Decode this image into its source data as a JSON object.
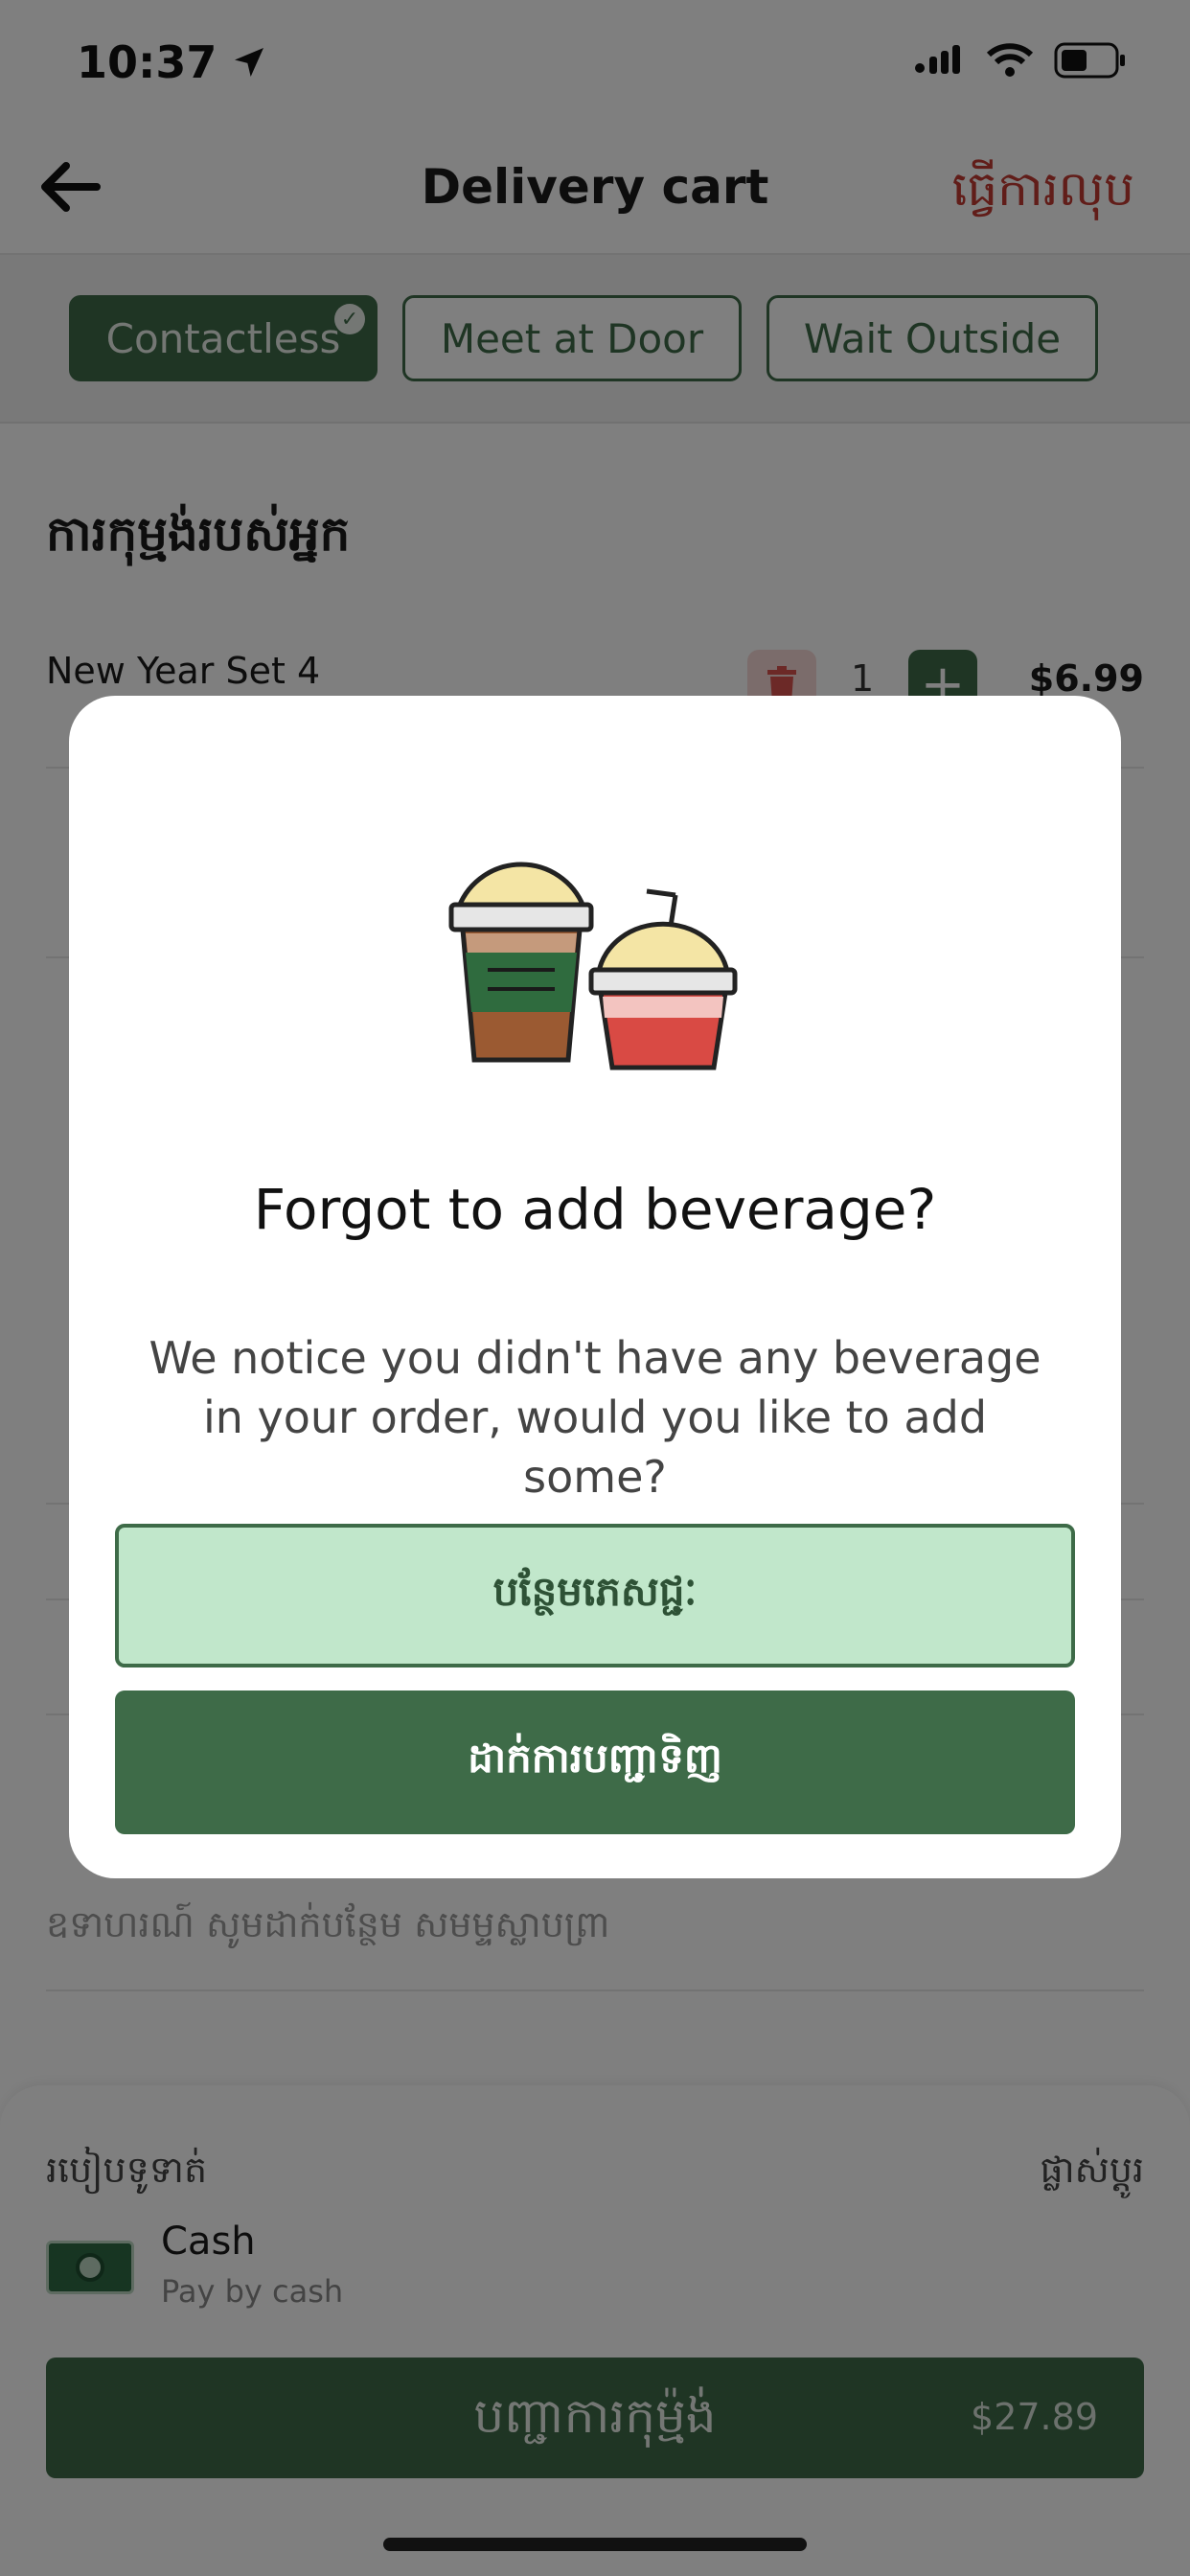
{
  "status_bar": {
    "time": "10:37"
  },
  "header": {
    "title": "Delivery cart",
    "clear_label": "ធ្វើការលុប"
  },
  "delivery_options": [
    {
      "label": "Contactless",
      "selected": true
    },
    {
      "label": "Meet at Door",
      "selected": false
    },
    {
      "label": "Wait Outside",
      "selected": false
    }
  ],
  "order": {
    "section_title": "ការកុម្មង់របស់អ្នក",
    "items": [
      {
        "name": "New Year Set 4",
        "quantity": "1",
        "price": "$6.99"
      }
    ]
  },
  "payment": {
    "label": "របៀបទូទាត់",
    "change_label": "ផ្លាស់ប្តូរ",
    "method": "Cash",
    "method_sub": "Pay by cash"
  },
  "note": {
    "placeholder": "ឧទាហរណ៍ សូមដាក់បន្ថែម សមម្ទស្លាបព្រា"
  },
  "place_order": {
    "label": "បញ្ជាការកុម្ម៉ង់",
    "total": "$27.89"
  },
  "modal": {
    "title": "Forgot to add beverage?",
    "message": "We notice you didn't have any beverage in your order, would you like to add some?",
    "add_button": "បន្ថែមភេសជ្ជៈ",
    "continue_button": "ដាក់ការបញ្ជាទិញ",
    "illustration": "beverage-cups-icon"
  },
  "colors": {
    "brand_green": "#3e6b48",
    "light_green": "#c1e7cb",
    "danger_red": "#c23b32"
  }
}
